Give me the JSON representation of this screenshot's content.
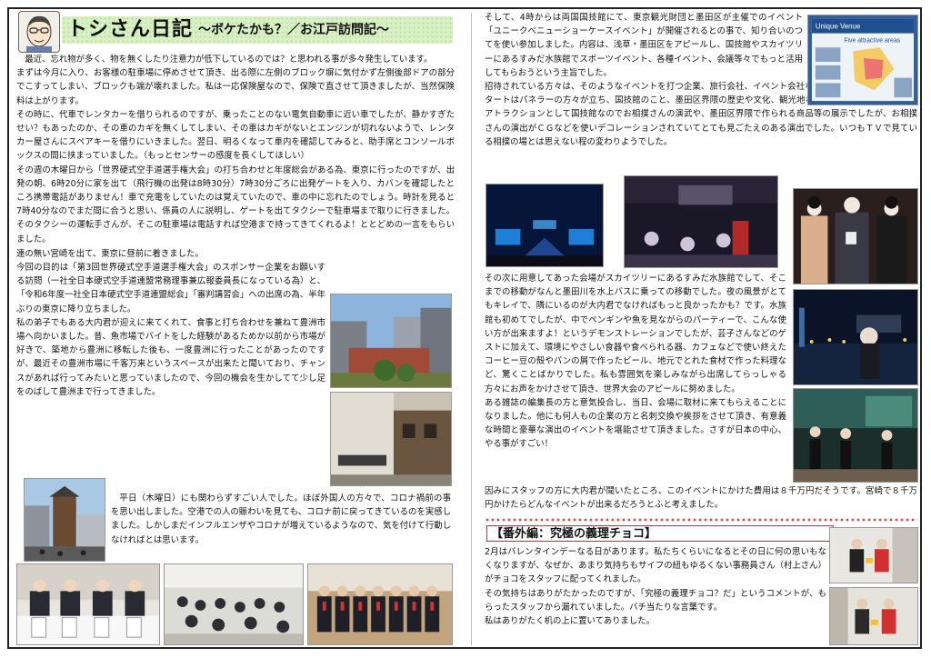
{
  "header": {
    "title_main": "トシさん日記",
    "title_sub": "～ボケたかも？／お江戸訪問記～"
  },
  "left": {
    "block1": [
      "最近、忘れ物が多く、物を無くしたり注意力が低下しているのでは？と思われる事が多々発生しています。",
      "まずは今月に入り、お客様の駐車場に停めさせて頂き、出る際に左側のブロック塀に気付かず左側後部ドアの部分でこすってしまい、ブロックも端が壊れました。私は一応保険屋なので、保険で直させて頂きましたが、当然保険料は上がります。",
      "その時に、代車でレンタカーを借りられるのですが、乗ったことのない電気自動車に近い車でしたが、静かすぎたせい？もあったのか、その車のカギを無くしてしまい、その車はカギがないとエンジンが切れないようで、レンタカー屋さんにスペアキーを借りにいきました。翌日、明るくなって車内を確認してみると、助手席とコンソールボックスの間に挟まっていました。（もっとセンサーの感度を長くしてほしい）",
      "その週の木曜日から「世界硬式空手道選手権大会」の打ち合わせと年度総会がある為、東京に行ったのですが、出発の朝、6時20分に家を出て（飛行機の出発は8時30分）7時30分ごろに出発ゲートを入り、カバンを確認したところ携帯電話がありません！車で充電をしていたのは覚えていたので、車の中に忘れたのでしょう。時計を見ると7時40分なのでまだ間に合うと思い、係員の人に説明し、ゲートを出てタクシーで駐車場まで取りに行きました。そのタクシーの運転手さんが、そこの駐車場は電話すれば空港まで持ってきてくれるよ！ととどめの一言をもらいました。"
    ],
    "block2": [
      "連の無い宮崎を出て、東京に昼前に着きました。",
      "今回の目的は「第3回世界硬式空手道選手権大会」のスポンサー企業をお願いする訪問（一社全日本硬式空手道連盟常務理事兼広報委員長になっている為）と、「令和6年度一社全日本硬式空手道連盟総会」「審判講習会」への出席の為、半年ぶりの東京に降り立ちました。",
      "私の弟子でもある大内君が迎えに来てくれて、食事と打ち合わせを兼ねて豊洲市場へ向かいました。昔、魚市場でバイトをした経験があるためか以前から市場が好きで、築地から豊洲に移転した後も、一度豊洲に行ったことがあったのですが、最近その豊洲市場に千客万来というスペースが出来たと聞いており、チャンスがあれば行ってみたいと思っていましたので、今回の機会を生かしてて少し足をのばして豊洲まで行ってきました。"
    ],
    "block3": [
      "平日（木曜日）にも関わらずすごい人でした。ほぼ外国人の方々で、コロナ禍前の事を思い出しました。空港での人の賑わいを見ても、コロナ前に戻ってきているのを実感しました。しかしまだインフルエンザやコロナが増えているようなので、気を付けて行動しなければとは思います。"
    ]
  },
  "right": {
    "block1": [
      "そして、4時からは両国国技館にて、東京観光財団と墨田区が主催でのイベント「ユニークベニューショーケースイベント」が開催されるとの事で、知り合いのつてを使い参加しました。内容は、浅草・墨田区をアピールし、国技館やスカイツリーにあるすみだ水族館でスポーツイベント、各種イベント、会議等々でもっと活用してもらおうという主旨でした。",
      "招待されている方々は、そのようなイベントを打つ企業、旅行会社、イベント会社などの方々が中心でした。スタートはパネラーの方々が立ち、国技館のこと、墨田区界隈の歴史や文化、観光地などについての説明があり、アトラクションとして国技館なのでお相撲さんの演武や、墨田区界隈で作られる商品等の展示でしたが、お相撲さんの演出がＣＧなどを使いデコレーションされていてとても見ごたえのある演出でした。いつもＴＶで見ている相撲の場とは思えない程の変わりようでした。"
    ],
    "block2": [
      "その次に用意してあった会場がスカイツリーにあるすみだ水族館でして、そこまでの移動がなんと墨田川を水上バスに乗っての移動でした。夜の風景がとてもキレイで、隣にいるのが大内君でなければもっと良かったかも？です。水族館も初めてでしたが、中でペンギンや魚を見ながらのパーティーで、こんな使い方が出来ますよ！というデモンストレーションでしたが、芸子さんなどのゲストに加えて、環境にやさしい食器や食べられる器、カフェなどで使い終えたコーヒー豆の殻やパンの屑で作ったビール、地元でとれた食材で作った料理など、驚くことばかりでした。私も雰囲気を楽しみながら出席してらっしゃる方々にお声をかけさせて頂き、世界大会のアピールに努めました。",
      "ある雑誌の編集長の方と意気投合し、当日、会場に取材に来てもらえることになりました。他にも何人もの企業の方と名刺交換や挨拶をさせて頂き、有意義な時間と豪華な演出のイベントを堪能させて頂きました。さすが日本の中心、やる事がすごい！",
      "因みにスタッフの方に大内君が聞いたところ、このイベントにかけた費用は８千万円だそうです。宮崎で８千万円かけたらどんなイベントが出来るだろうとふと考えました。"
    ],
    "bonus_title": "【番外編：究極の義理チョコ】",
    "bonus": [
      "2月はバレンタインデーなる日があります。私たちくらいになるとその日に何の思いもなくなりますが、なぜか、あまり気持ちもサイフの紐もゆるくない事務員さん（村上さん）がチョコをスタッフに配ってくれました。",
      "その気持ちはありがたかったのですが、「究極の義理チョコ？だ」というコメントが、もらったスタッフから漏れていました。バチ当たりな言葉です。",
      "私はありがたく机の上に置いてありました。"
    ],
    "poster": {
      "heading": "Unique Venue",
      "sub": "Five attractive areas"
    }
  }
}
